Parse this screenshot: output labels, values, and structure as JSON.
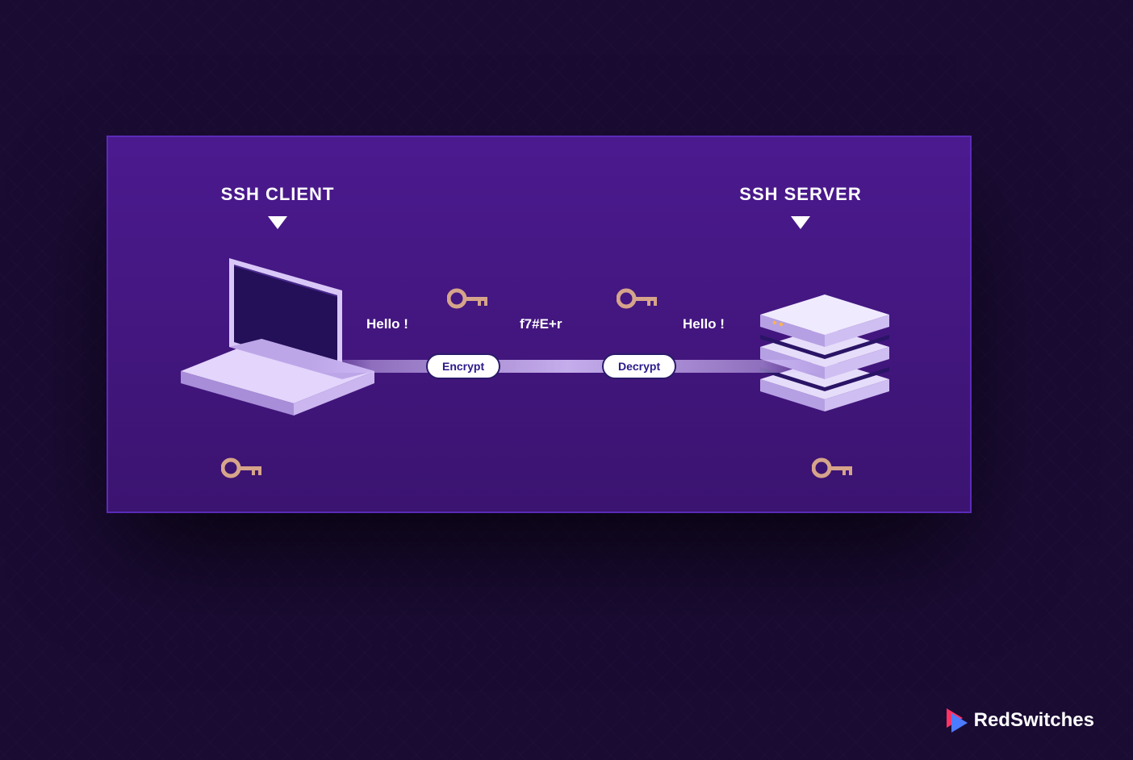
{
  "diagram": {
    "left_title": "SSH CLIENT",
    "right_title": "SSH SERVER",
    "plaintext_before": "Hello !",
    "ciphertext": "f7#E+r",
    "plaintext_after": "Hello !",
    "encrypt_label": "Encrypt",
    "decrypt_label": "Decrypt"
  },
  "brand": {
    "name": "RedSwitches"
  },
  "colors": {
    "bg": "#1a0b33",
    "card_top": "#4b1a8f",
    "card_bottom": "#3b1370",
    "card_border": "#5b2bb8",
    "key": "#d6a48a",
    "key_shadow": "#b07f66",
    "pill_text": "#2a1a8a",
    "brand_accent1": "#ff3366",
    "brand_accent2": "#4b7bff"
  }
}
